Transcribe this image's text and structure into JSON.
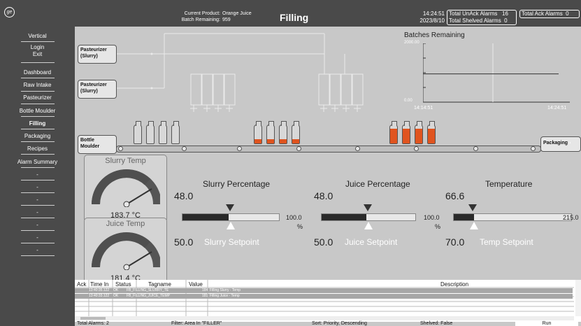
{
  "header": {
    "logo_icon": "ge-logo-icon",
    "current_product_label": "Current Product:",
    "current_product_value": "Orange Juice",
    "batch_remaining_label": "Batch Remaining:",
    "batch_remaining_value": "959",
    "title": "Filling",
    "time": "14:24:51",
    "date": "2023/8/10",
    "unack_label": "Total UnAck Alarms",
    "unack_value": "16",
    "shelved_label": "Total Shelved Alarms",
    "shelved_value": "0",
    "ack_label": "Total Ack Alarms",
    "ack_value": "0"
  },
  "sidebar": {
    "vertical": "Vertical",
    "login": "Login",
    "exit": "Exit",
    "items": [
      "Dashboard",
      "Raw Intake",
      "Pasteurizer",
      "Bottle Moulder",
      "Filling",
      "Packaging",
      "Recipes",
      "Alarm Summary"
    ],
    "placeholders": [
      "-",
      "-",
      "-",
      "-",
      "-",
      "-",
      "-"
    ]
  },
  "process": {
    "pasteurizer_1": "Pasteurizer (Slurry)",
    "pasteurizer_2": "Pasteurizer (Slurry)",
    "bottle_moulder": "Bottle Moulder",
    "packaging": "Packaging",
    "bottle_groups": [
      {
        "fill": 0.0
      },
      {
        "fill": 0.25
      },
      {
        "fill": 0.8
      }
    ]
  },
  "trend": {
    "title": "Batches Remaining",
    "ymax": "2000.00",
    "ymin": "0.00",
    "x_start": "14:14:51",
    "x_end": "14:24:51",
    "value_fraction": 0.48
  },
  "gauges": [
    {
      "title": "Slurry Temp",
      "value": "183.7 °C",
      "fraction": 0.78
    },
    {
      "title": "Juice Temp",
      "value": "181.4 °C",
      "fraction": 0.78
    }
  ],
  "bars": [
    {
      "title": "Slurry Percentage",
      "value": "48.0",
      "max": "100.0",
      "unit": "%",
      "setpoint_label": "Slurry Setpoint",
      "setpoint": "50.0",
      "fraction": 0.48,
      "sp_fraction": 0.5
    },
    {
      "title": "Juice Percentage",
      "value": "48.0",
      "max": "100.0",
      "unit": "%",
      "setpoint_label": "Juice Setpoint",
      "setpoint": "50.0",
      "fraction": 0.48,
      "sp_fraction": 0.5
    },
    {
      "title": "Temperature",
      "value": "66.6",
      "max": "215.0",
      "unit": "\u0000",
      "setpoint_label": "Temp Setpoint",
      "setpoint": "70.0",
      "fraction": 0.31,
      "sp_fraction": 0.33
    }
  ],
  "alarm_table": {
    "headers": [
      "Ack",
      "Time In",
      "Status",
      "Tagname",
      "Value",
      "Description"
    ],
    "rows": [
      {
        "time": "13:40:35.122",
        "status": "OK",
        "tag": "FB_FILLING_SLURRY_TE",
        "value": "184",
        "desc": "Filling Slurry - Temp"
      },
      {
        "time": "13:40:33.122",
        "status": "OK",
        "tag": "FB_FILLING_JUICE_TEMP",
        "value": "181",
        "desc": "Filling Juice - Temp"
      }
    ]
  },
  "footer": {
    "total": "Total Alarms: 2",
    "filter": "Filter: Area In \"FILLER\"",
    "sort": "Sort: Priority, Descending",
    "shelved": "Shelved: False",
    "run": "Run"
  }
}
